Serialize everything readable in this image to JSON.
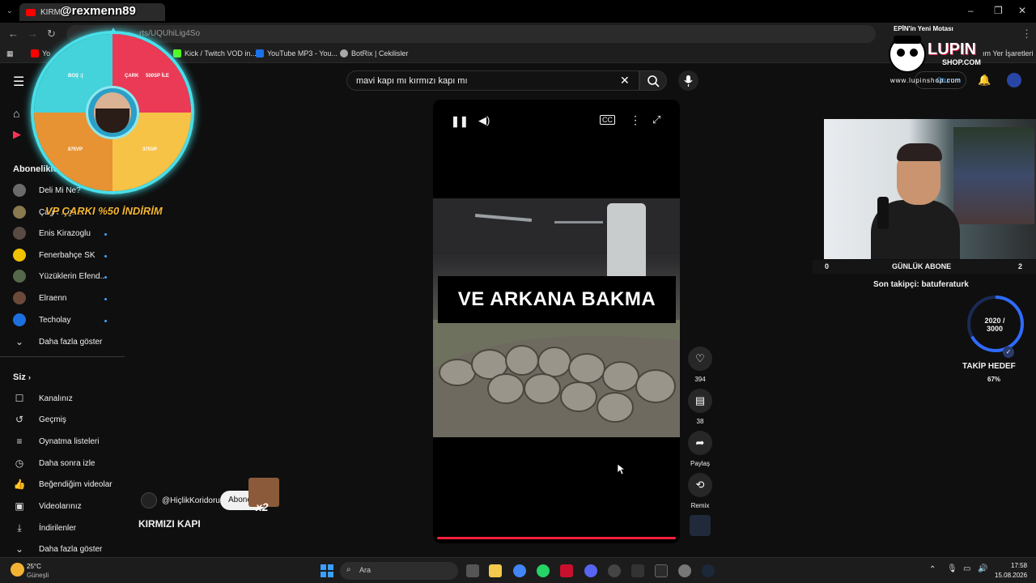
{
  "browser": {
    "tab_title": "KIRMIZI",
    "url": "rts/UQUhiLig4So",
    "bookmarks": [
      "Yo",
      "Kick / Twitch VOD in...",
      "YouTube MP3 - You...",
      "BotRix | Cekilisler",
      "ım Yer İşaretleri"
    ]
  },
  "overlay": {
    "username": "@rexmenn89",
    "wheel": {
      "labels": [
        "BOŞ :(",
        "ÇARK",
        "500SP İLE",
        "875VP",
        "375VP"
      ]
    },
    "promo": "VP ÇARKI %50 İNDİRİM",
    "ticker": "EPİN'in Yeni Motası",
    "logo_text": "LUPIN",
    "logo_sub": "SHOP.COM",
    "site": "www.lupinshop.com",
    "follow_count_left": "0",
    "follow_label": "GÜNLÜK ABONE",
    "follow_count_right": "2",
    "last_follower": "Son takipçi: batuferaturk",
    "goal_value": "2020 /\n3000",
    "goal_label": "TAKİP HEDEF",
    "goal_percent": "67%",
    "goal_fraction": 0.67
  },
  "youtube": {
    "search_value": "mavi kapı mı kırmızı kapı mı",
    "sign_in": "Oturum",
    "sidebar": {
      "subs_heading": "Abonelikler",
      "subs": [
        {
          "label": "Deli Mi Ne?",
          "color": "#6b6b6b"
        },
        {
          "label": "Çağrı ...gr...",
          "color": "#8a7a50"
        },
        {
          "label": "Enis Kirazoglu",
          "color": "#5a4a44"
        },
        {
          "label": "Fenerbahçe SK",
          "color": "#f2c200"
        },
        {
          "label": "Yüzüklerin Efend...",
          "color": "#56684a"
        },
        {
          "label": "Elraenn",
          "color": "#6b4a3a"
        },
        {
          "label": "Techolay",
          "color": "#1d6fe0"
        }
      ],
      "more_subs": "Daha fazla göster",
      "you_heading": "Siz",
      "you_items": [
        "Kanalınız",
        "Geçmiş",
        "Oynatma listeleri",
        "Daha sonra izle",
        "Beğendiğim videolar",
        "Videolarınız",
        "İndirilenler",
        "Daha fazla göster"
      ]
    },
    "video": {
      "caption": "VE ARKANA BAKMA",
      "channel": "@HiçlikKoridoru",
      "subscribe": "Abone",
      "title": "KIRMIZI KAPI",
      "badge": "x2"
    },
    "actions": {
      "likes": "394",
      "comments": "38",
      "share": "Paylaş",
      "remix": "Remix"
    }
  },
  "taskbar": {
    "weather_temp": "25°C",
    "weather_desc": "Güneşli",
    "search_placeholder": "Ara",
    "time": "17:58",
    "date": "15.08.2026"
  }
}
